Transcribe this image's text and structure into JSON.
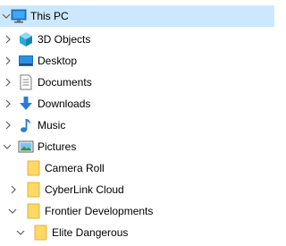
{
  "tree": {
    "this_pc": "This PC",
    "objects3d": "3D Objects",
    "desktop": "Desktop",
    "documents": "Documents",
    "downloads": "Downloads",
    "music": "Music",
    "pictures": "Pictures",
    "camera_roll": "Camera Roll",
    "cyberlink_cloud": "CyberLink Cloud",
    "frontier_developments": "Frontier Developments",
    "elite_dangerous": "Elite Dangerous"
  },
  "colors": {
    "selection": "#cce8ff",
    "folder": "#ffd865",
    "arrow": "#5f5f5f"
  }
}
